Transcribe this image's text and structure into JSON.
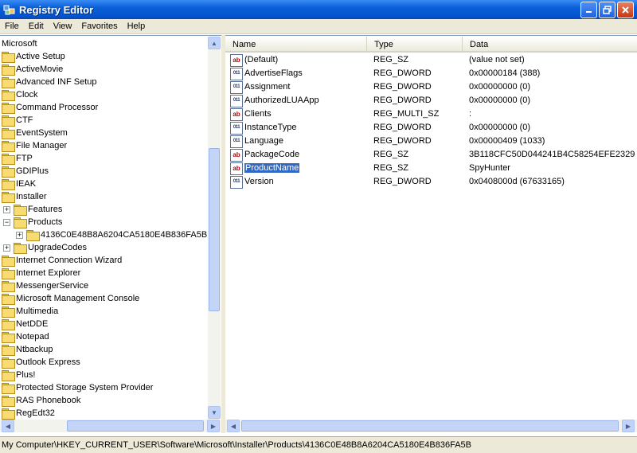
{
  "window": {
    "title": "Registry Editor"
  },
  "menu": {
    "file": "File",
    "edit": "Edit",
    "view": "View",
    "favorites": "Favorites",
    "help": "Help"
  },
  "tree": {
    "top_label": "Microsoft",
    "items": [
      {
        "label": "Active Setup",
        "level": 0
      },
      {
        "label": "ActiveMovie",
        "level": 0
      },
      {
        "label": "Advanced INF Setup",
        "level": 0
      },
      {
        "label": "Clock",
        "level": 0
      },
      {
        "label": "Command Processor",
        "level": 0
      },
      {
        "label": "CTF",
        "level": 0
      },
      {
        "label": "EventSystem",
        "level": 0
      },
      {
        "label": "File Manager",
        "level": 0
      },
      {
        "label": "FTP",
        "level": 0
      },
      {
        "label": "GDIPlus",
        "level": 0
      },
      {
        "label": "IEAK",
        "level": 0
      },
      {
        "label": "Installer",
        "level": 0
      },
      {
        "label": "Features",
        "level": 1
      },
      {
        "label": "Products",
        "level": 1
      },
      {
        "label": "4136C0E48B8A6204CA5180E4B836FA5B",
        "level": 2
      },
      {
        "label": "UpgradeCodes",
        "level": 1
      },
      {
        "label": "Internet Connection Wizard",
        "level": 0
      },
      {
        "label": "Internet Explorer",
        "level": 0
      },
      {
        "label": "MessengerService",
        "level": 0
      },
      {
        "label": "Microsoft Management Console",
        "level": 0
      },
      {
        "label": "Multimedia",
        "level": 0
      },
      {
        "label": "NetDDE",
        "level": 0
      },
      {
        "label": "Notepad",
        "level": 0
      },
      {
        "label": "Ntbackup",
        "level": 0
      },
      {
        "label": "Outlook Express",
        "level": 0
      },
      {
        "label": "Plus!",
        "level": 0
      },
      {
        "label": "Protected Storage System Provider",
        "level": 0
      },
      {
        "label": "RAS Phonebook",
        "level": 0
      },
      {
        "label": "RegEdt32",
        "level": 0
      }
    ]
  },
  "list": {
    "columns": {
      "name": "Name",
      "type": "Type",
      "data": "Data"
    },
    "rows": [
      {
        "name": "(Default)",
        "type": "REG_SZ",
        "data": "(value not set)",
        "icon": "string-value-icon"
      },
      {
        "name": "AdvertiseFlags",
        "type": "REG_DWORD",
        "data": "0x00000184 (388)",
        "icon": "binary-value-icon"
      },
      {
        "name": "Assignment",
        "type": "REG_DWORD",
        "data": "0x00000000 (0)",
        "icon": "binary-value-icon"
      },
      {
        "name": "AuthorizedLUAApp",
        "type": "REG_DWORD",
        "data": "0x00000000 (0)",
        "icon": "binary-value-icon"
      },
      {
        "name": "Clients",
        "type": "REG_MULTI_SZ",
        "data": ":",
        "icon": "string-value-icon"
      },
      {
        "name": "InstanceType",
        "type": "REG_DWORD",
        "data": "0x00000000 (0)",
        "icon": "binary-value-icon"
      },
      {
        "name": "Language",
        "type": "REG_DWORD",
        "data": "0x00000409 (1033)",
        "icon": "binary-value-icon"
      },
      {
        "name": "PackageCode",
        "type": "REG_SZ",
        "data": "3B118CFC50D044241B4C58254EFE2329",
        "icon": "string-value-icon"
      },
      {
        "name": "ProductName",
        "type": "REG_SZ",
        "data": "SpyHunter",
        "icon": "string-value-icon",
        "selected": true
      },
      {
        "name": "Version",
        "type": "REG_DWORD",
        "data": "0x0408000d (67633165)",
        "icon": "binary-value-icon"
      }
    ]
  },
  "status": {
    "path": "My Computer\\HKEY_CURRENT_USER\\Software\\Microsoft\\Installer\\Products\\4136C0E48B8A6204CA5180E4B836FA5B"
  }
}
